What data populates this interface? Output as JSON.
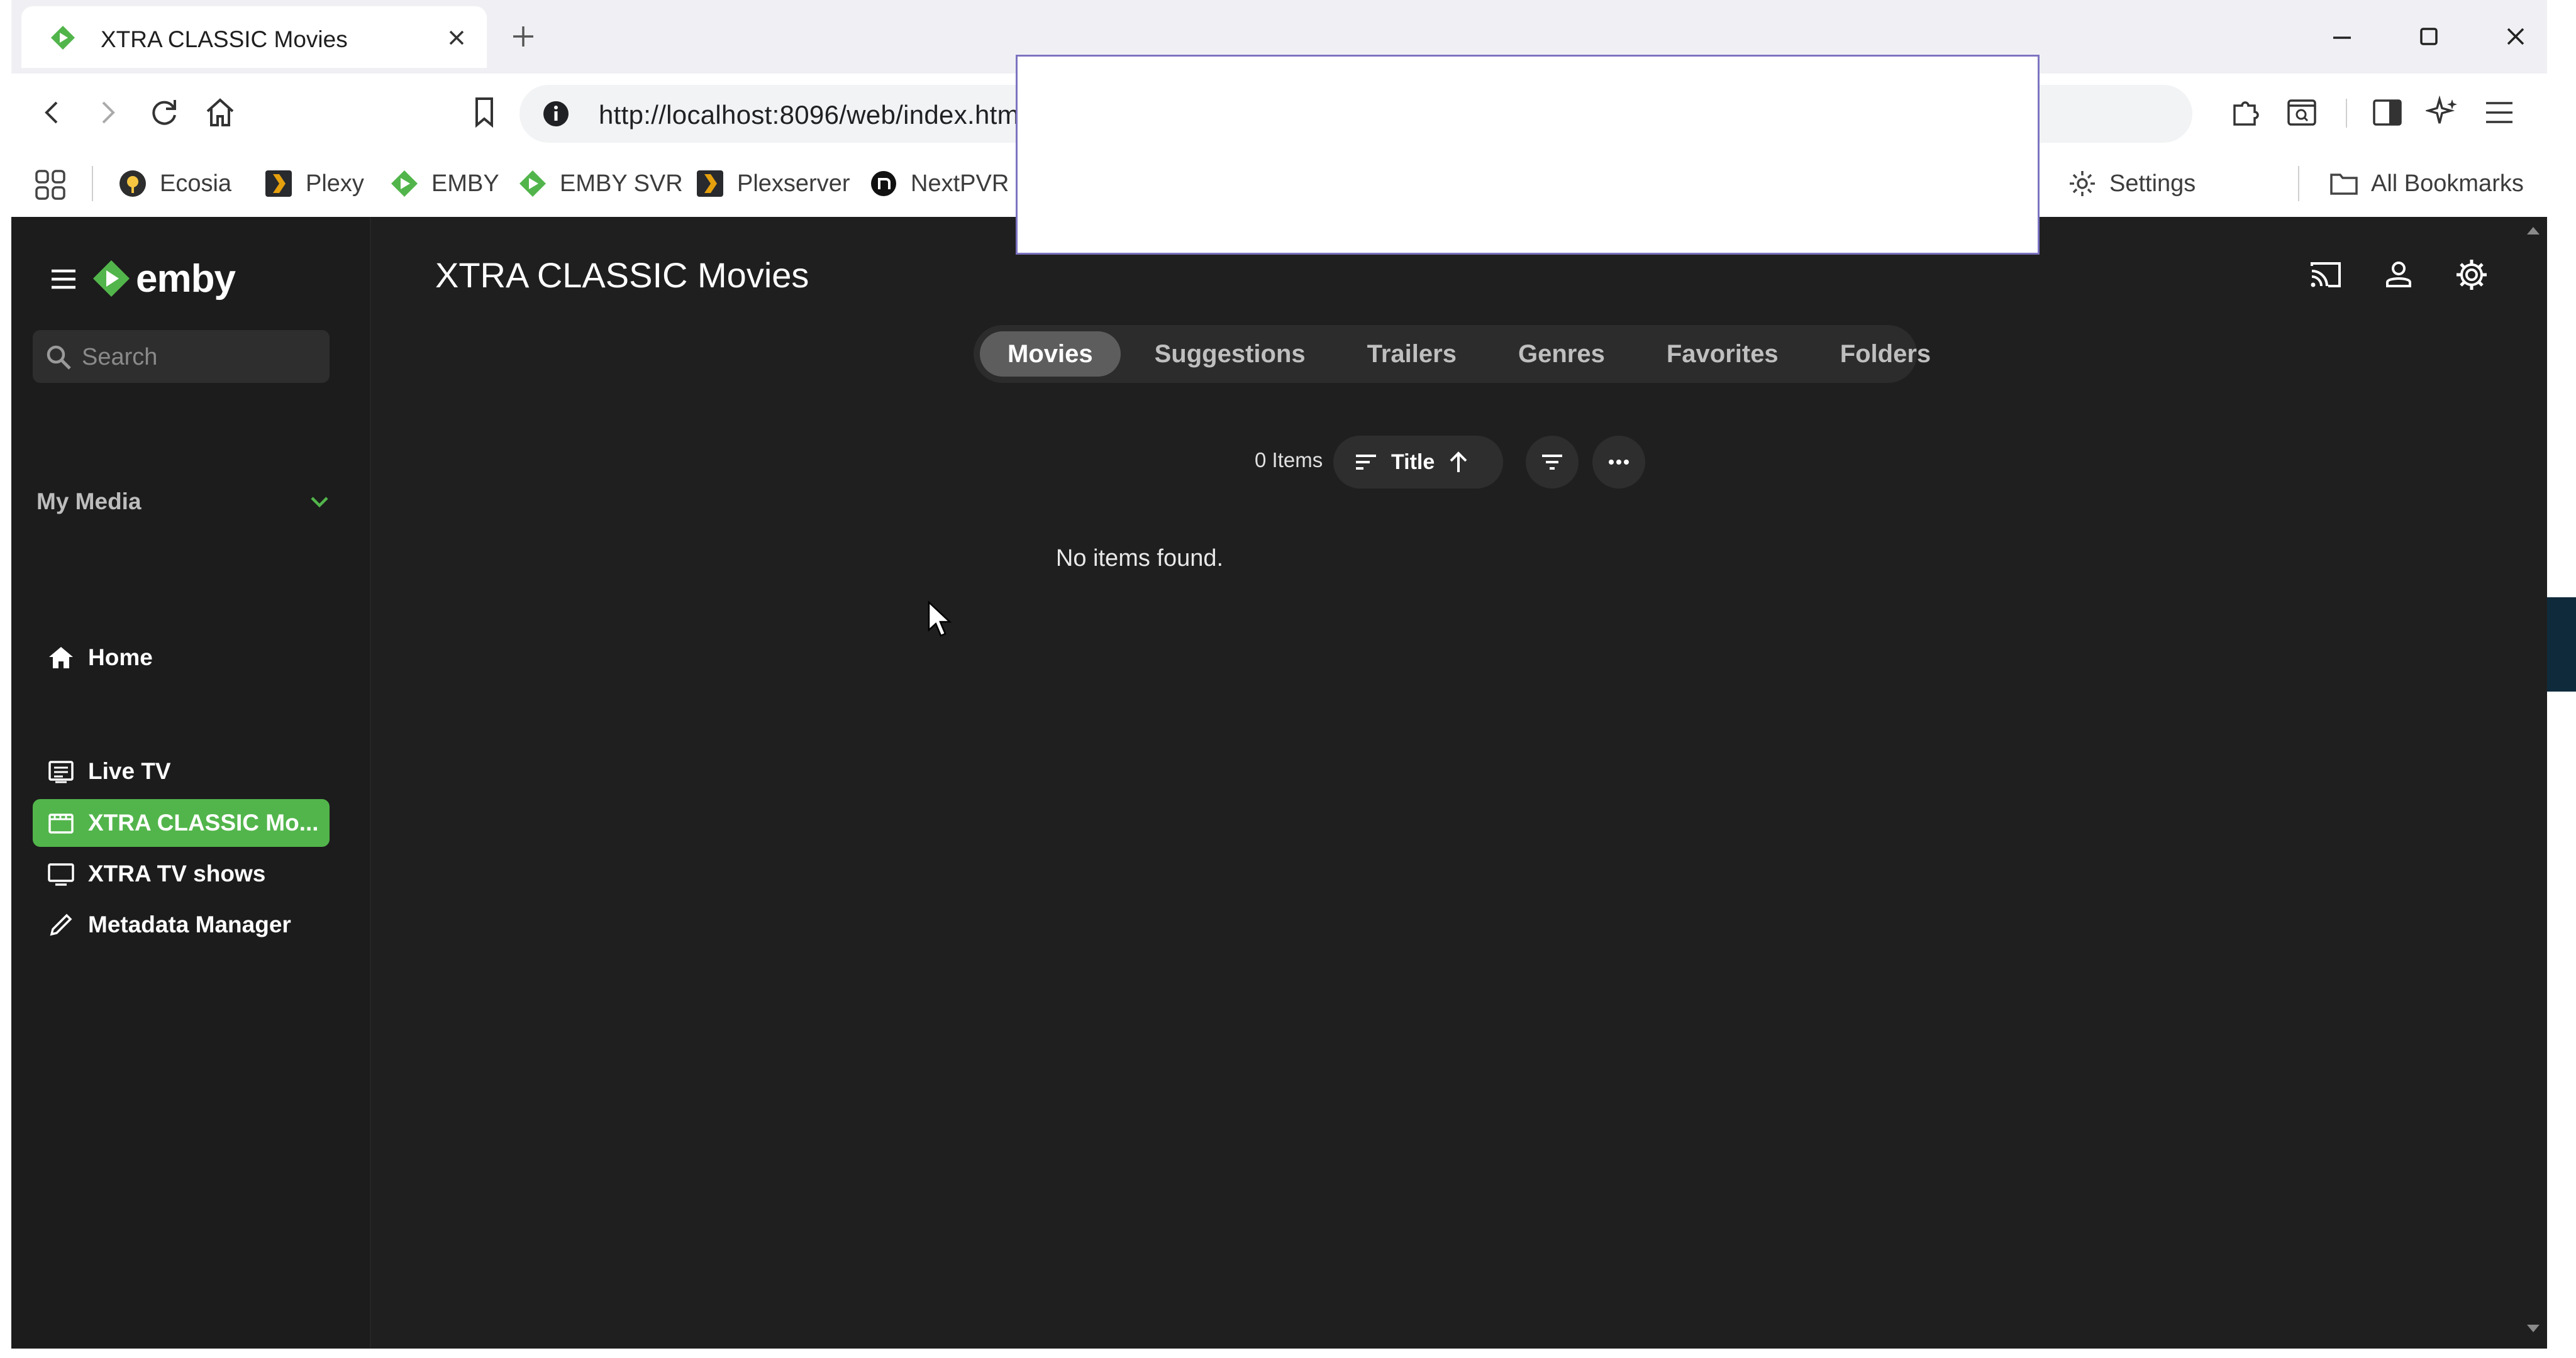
{
  "browser": {
    "tab_title": "XTRA CLASSIC Movies",
    "url": "http://localhost:8096/web/index.htm",
    "bookmarks": [
      {
        "label": "Ecosia",
        "icon": "ecosia-icon"
      },
      {
        "label": "Plexy",
        "icon": "plex-icon"
      },
      {
        "label": "EMBY",
        "icon": "emby-icon"
      },
      {
        "label": "EMBY SVR",
        "icon": "emby-icon"
      },
      {
        "label": "Plexserver",
        "icon": "plex-icon"
      },
      {
        "label": "NextPVR",
        "icon": "nextpvr-icon"
      }
    ],
    "bookmark_settings": "Settings",
    "all_bookmarks": "All Bookmarks"
  },
  "sidebar": {
    "logo_text": "emby",
    "search_placeholder": "Search",
    "home": "Home",
    "section_title": "My Media",
    "items": [
      {
        "label": "Live TV",
        "icon": "live-tv-icon"
      },
      {
        "label": "XTRA CLASSIC Mo...",
        "icon": "movies-icon",
        "active": true
      },
      {
        "label": "XTRA TV shows",
        "icon": "tv-icon"
      },
      {
        "label": "Metadata Manager",
        "icon": "pencil-icon"
      }
    ]
  },
  "main": {
    "title": "XTRA CLASSIC Movies",
    "tabs": [
      "Movies",
      "Suggestions",
      "Trailers",
      "Genres",
      "Favorites",
      "Folders"
    ],
    "active_tab": "Movies",
    "items_count": "0 Items",
    "sort_label": "Title",
    "empty_message": "No items found."
  },
  "colors": {
    "accent": "#52b54b",
    "background": "#1f1f1f",
    "sidebar": "#1c1c1c"
  }
}
